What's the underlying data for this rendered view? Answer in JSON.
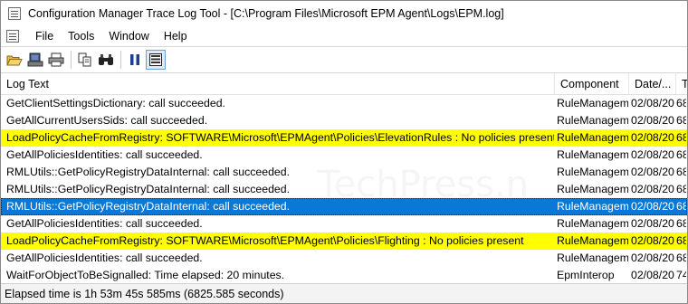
{
  "window": {
    "title": "Configuration Manager Trace Log Tool - [C:\\Program Files\\Microsoft EPM Agent\\Logs\\EPM.log]"
  },
  "menu": {
    "items": [
      "File",
      "Tools",
      "Window",
      "Help"
    ]
  },
  "toolbar": {
    "buttons": [
      "open-icon",
      "print-preview-icon",
      "print-icon",
      "copy-icon",
      "find-icon",
      "pause-icon",
      "highlight-icon"
    ]
  },
  "watermark": "TechPress.n",
  "columns": [
    "Log Text",
    "Component",
    "Date/...",
    "T"
  ],
  "rows": [
    {
      "text": "GetClientSettingsDictionary: call succeeded.",
      "component": "RuleManagem",
      "date": "02/08/20",
      "time": "68",
      "state": "normal"
    },
    {
      "text": "GetAllCurrentUsersSids: call succeeded.",
      "component": "RuleManagem",
      "date": "02/08/20",
      "time": "68",
      "state": "normal"
    },
    {
      "text": "LoadPolicyCacheFromRegistry: SOFTWARE\\Microsoft\\EPMAgent\\Policies\\ElevationRules : No policies present",
      "component": "RuleManagem",
      "date": "02/08/20",
      "time": "68",
      "state": "highlight"
    },
    {
      "text": "GetAllPoliciesIdentities: call succeeded.",
      "component": "RuleManagem",
      "date": "02/08/20",
      "time": "68",
      "state": "normal"
    },
    {
      "text": "RMLUtils::GetPolicyRegistryDataInternal: call succeeded.",
      "component": "RuleManagem",
      "date": "02/08/20",
      "time": "68",
      "state": "normal"
    },
    {
      "text": "RMLUtils::GetPolicyRegistryDataInternal: call succeeded.",
      "component": "RuleManagem",
      "date": "02/08/20",
      "time": "68",
      "state": "normal"
    },
    {
      "text": "RMLUtils::GetPolicyRegistryDataInternal: call succeeded.",
      "component": "RuleManagem",
      "date": "02/08/20",
      "time": "68",
      "state": "selected"
    },
    {
      "text": "GetAllPoliciesIdentities: call succeeded.",
      "component": "RuleManagem",
      "date": "02/08/20",
      "time": "68",
      "state": "normal"
    },
    {
      "text": "LoadPolicyCacheFromRegistry: SOFTWARE\\Microsoft\\EPMAgent\\Policies\\Flighting : No policies present",
      "component": "RuleManagem",
      "date": "02/08/20",
      "time": "68",
      "state": "highlight"
    },
    {
      "text": "GetAllPoliciesIdentities: call succeeded.",
      "component": "RuleManagem",
      "date": "02/08/20",
      "time": "68",
      "state": "normal"
    },
    {
      "text": "WaitForObjectToBeSignalled: Time elapsed: 20 minutes.",
      "component": "EpmInterop",
      "date": "02/08/20",
      "time": "74",
      "state": "normal"
    }
  ],
  "status": {
    "text": "Elapsed time is 1h 53m 45s 585ms (6825.585 seconds)"
  },
  "colors": {
    "highlight": "#ffff00",
    "selected": "#0a78d7"
  }
}
